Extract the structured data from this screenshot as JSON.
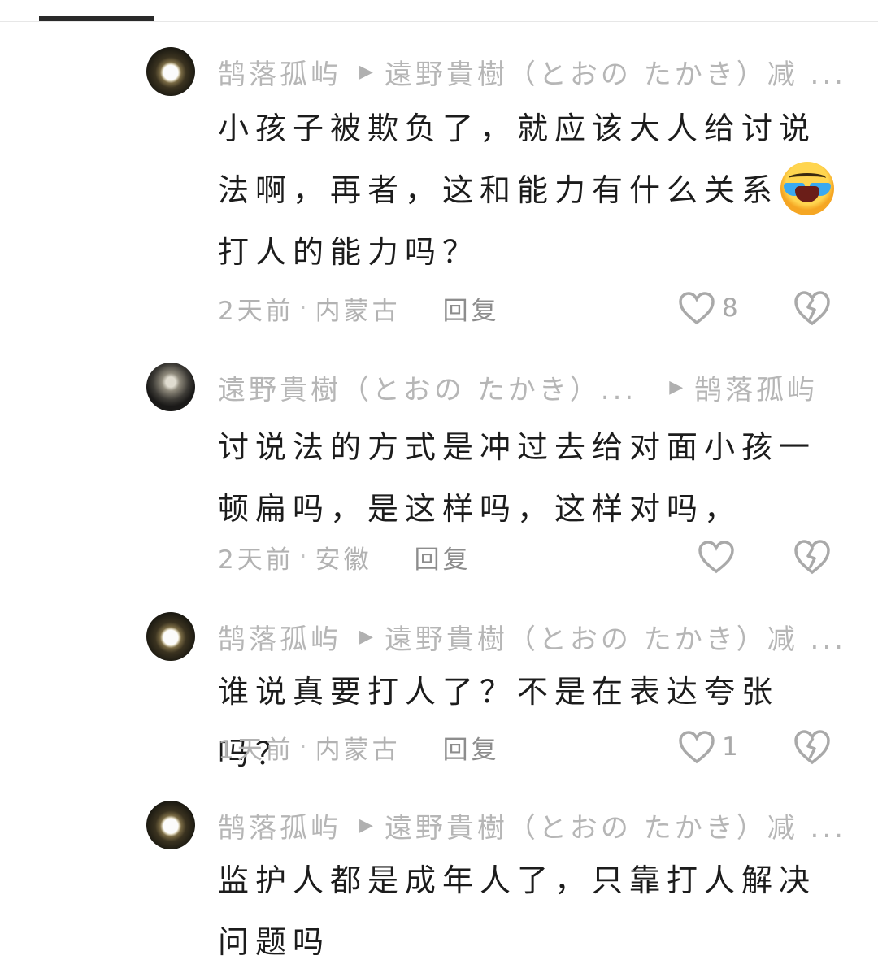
{
  "comments": [
    {
      "author": "鹄落孤屿",
      "reply_to": "遠野貴樹（とおの たかき）减 ...",
      "text_before_emoji": "小孩子被欺负了，就应该大人给讨说法啊，再者，这和能力有什么关系",
      "emoji": "laughing-crying-emoji",
      "text_after_emoji": "打人的能力吗？",
      "time": "2天前",
      "location": "内蒙古",
      "reply_label": "回复",
      "likes": "8"
    },
    {
      "author": "遠野貴樹（とおの たかき）...",
      "reply_to": "鹄落孤屿",
      "text": "讨说法的方式是冲过去给对面小孩一顿扁吗，是这样吗，这样对吗，",
      "time": "2天前",
      "location": "安徽",
      "reply_label": "回复"
    },
    {
      "author": "鹄落孤屿",
      "reply_to": "遠野貴樹（とおの たかき）减 ...",
      "text": "谁说真要打人了？不是在表达夸张吗？",
      "time": "1天前",
      "location": "内蒙古",
      "reply_label": "回复",
      "likes": "1"
    },
    {
      "author": "鹄落孤屿",
      "reply_to": "遠野貴樹（とおの たかき）减 ...",
      "text": "监护人都是成年人了，只靠打人解决问题吗"
    }
  ],
  "icons": {
    "reply_arrow": "play-arrow-icon",
    "like": "heart-outline-icon",
    "dislike": "broken-heart-icon"
  },
  "colors": {
    "meta_text": "#b2b2b2",
    "body_text": "#1c1c1c",
    "icon_stroke": "#a9a9a9"
  }
}
